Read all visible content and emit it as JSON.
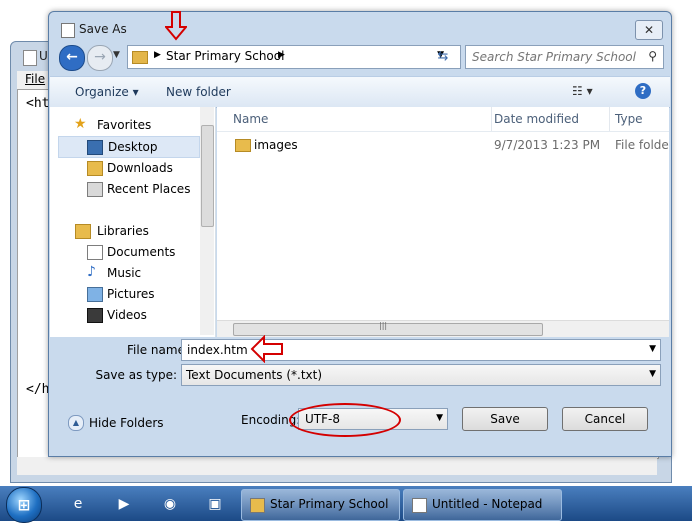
{
  "notepad": {
    "title": "U",
    "menu_file": "File",
    "line1": "<ht",
    "line2": "</h"
  },
  "dialog": {
    "title": "Save As",
    "close_glyph": "✕",
    "address": {
      "crumb": "Star Primary School"
    },
    "search": {
      "placeholder": "Search Star Primary School"
    },
    "toolbar": {
      "organize": "Organize ▾",
      "new_folder": "New folder",
      "view_glyph": "☷ ▾",
      "help_glyph": "?"
    },
    "nav": {
      "favorites": "Favorites",
      "desktop": "Desktop",
      "downloads": "Downloads",
      "recent": "Recent Places",
      "libraries": "Libraries",
      "documents": "Documents",
      "music": "Music",
      "pictures": "Pictures",
      "videos": "Videos"
    },
    "columns": {
      "name": "Name",
      "date": "Date modified",
      "type": "Type"
    },
    "files": [
      {
        "name": "images",
        "date": "9/7/2013 1:23 PM",
        "type": "File folder"
      }
    ],
    "file_name_label": "File name:",
    "file_name_value": "index.htm",
    "save_type_label": "Save as type:",
    "save_type_value": "Text Documents (*.txt)",
    "hide_folders": "Hide Folders",
    "encoding_label": "Encoding:",
    "encoding_value": "UTF-8",
    "save_button": "Save",
    "cancel_button": "Cancel"
  },
  "taskbar": {
    "tasks": [
      {
        "label": "Star Primary School"
      },
      {
        "label": "Untitled - Notepad"
      }
    ]
  },
  "colors": {
    "annotation": "#d40000",
    "accent": "#2f6dc4"
  }
}
